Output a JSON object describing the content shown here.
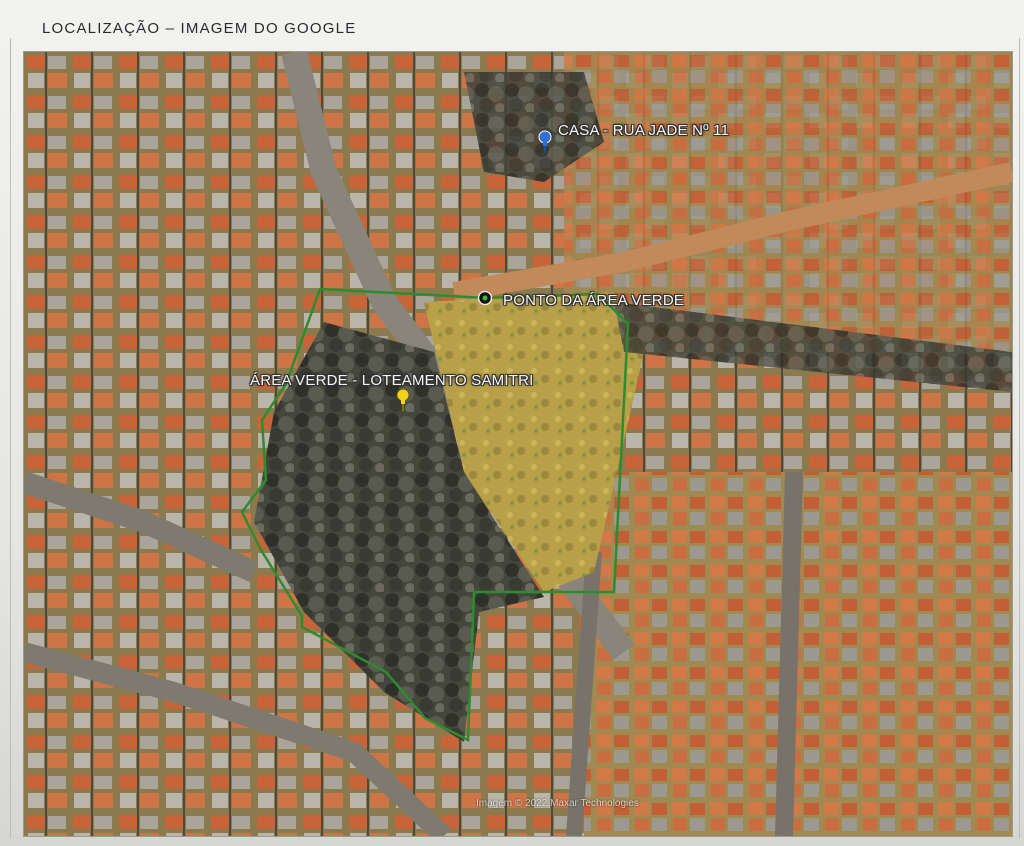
{
  "document": {
    "header": "LOCALIZAÇÃO – IMAGEM DO GOOGLE"
  },
  "map": {
    "type": "satellite",
    "colors": {
      "boundary": "#2e8b2e",
      "blue_pin": "#2f6fd6",
      "yellow_pin": "#f2d21b",
      "roof_tile": "#c8643a",
      "vegetation": "#3d3f36"
    },
    "markers": [
      {
        "label": "CASA - RUA JADE Nº 11",
        "icon": "blue-pushpin-icon"
      },
      {
        "label": "PONTO DA ÁREA VERDE",
        "icon": "target-point-icon"
      },
      {
        "label": "ÁREA VERDE - LOTEAMENTO SAMITRI",
        "icon": "yellow-pushpin-icon"
      }
    ],
    "boundary_name": "",
    "attribution": "Imagem © 2022 Maxar Technologies"
  }
}
